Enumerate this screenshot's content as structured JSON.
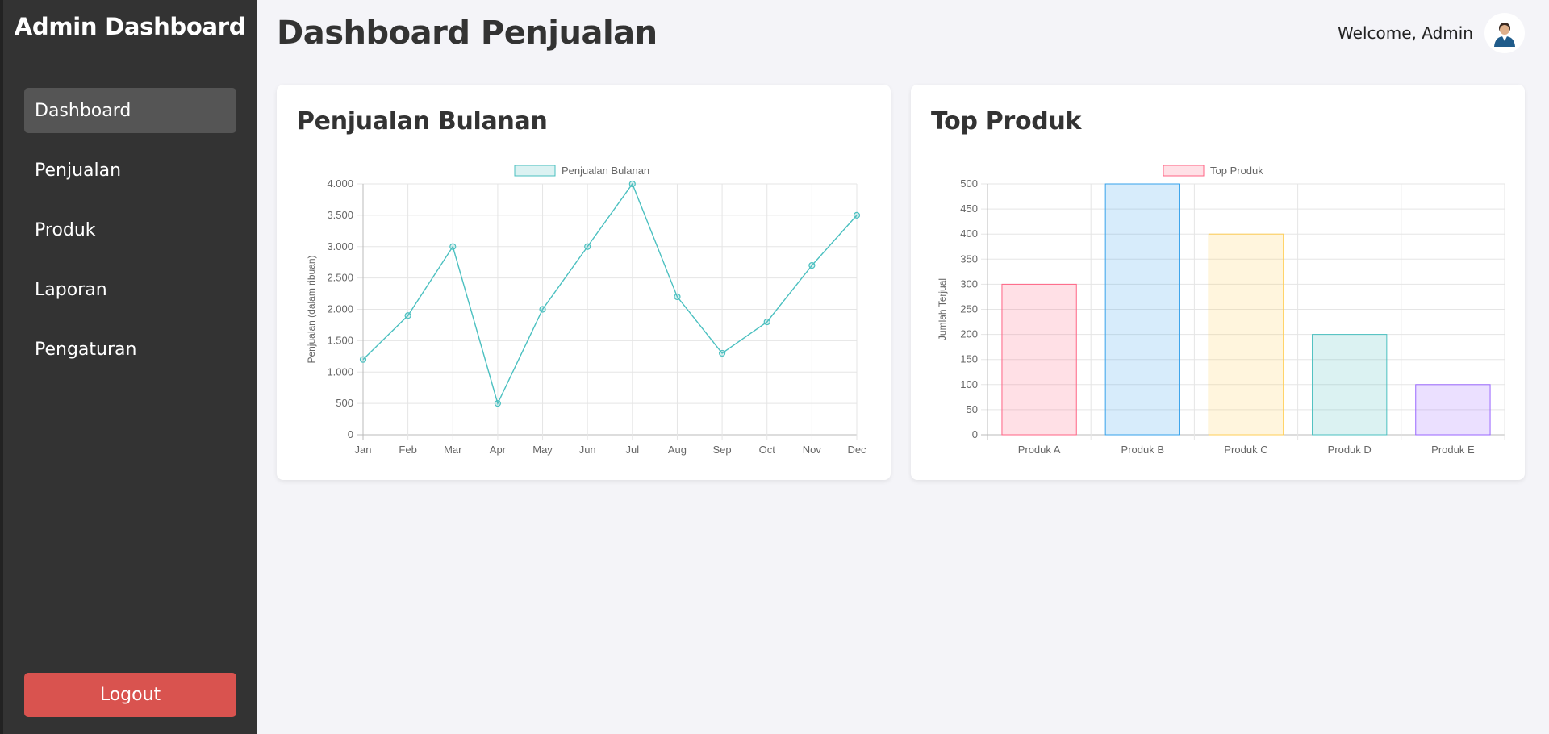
{
  "sidebar": {
    "brand": "Admin Dashboard",
    "items": [
      {
        "label": "Dashboard",
        "active": true
      },
      {
        "label": "Penjualan",
        "active": false
      },
      {
        "label": "Produk",
        "active": false
      },
      {
        "label": "Laporan",
        "active": false
      },
      {
        "label": "Pengaturan",
        "active": false
      }
    ],
    "logout_label": "Logout"
  },
  "header": {
    "title": "Dashboard Penjualan",
    "welcome": "Welcome, Admin",
    "avatar_icon": "user-avatar-icon"
  },
  "cards": {
    "monthly": {
      "title": "Penjualan Bulanan"
    },
    "top": {
      "title": "Top Produk"
    }
  },
  "colors": {
    "sidebar_bg": "#333333",
    "active_item_bg": "#555555",
    "logout_bg": "#d9534f",
    "line": "#4bc0c0",
    "line_fill": "rgba(75,192,192,0.2)"
  },
  "chart_data": [
    {
      "type": "line",
      "legend": "Penjualan Bulanan",
      "legend_position": "top",
      "categories": [
        "Jan",
        "Feb",
        "Mar",
        "Apr",
        "May",
        "Jun",
        "Jul",
        "Aug",
        "Sep",
        "Oct",
        "Nov",
        "Dec"
      ],
      "values": [
        1200,
        1900,
        3000,
        500,
        2000,
        3000,
        4000,
        2200,
        1300,
        1800,
        2700,
        3500
      ],
      "ylabel": "Penjualan (dalam ribuan)",
      "ylim": [
        0,
        4000
      ],
      "yticks": [
        "0",
        "500",
        "1.000",
        "1.500",
        "2.000",
        "2.500",
        "3.000",
        "3.500",
        "4.000"
      ],
      "grid": true,
      "color": "#4bc0c0"
    },
    {
      "type": "bar",
      "legend": "Top Produk",
      "legend_position": "top",
      "categories": [
        "Produk A",
        "Produk B",
        "Produk C",
        "Produk D",
        "Produk E"
      ],
      "values": [
        300,
        500,
        400,
        200,
        100
      ],
      "ylabel": "Jumlah Terjual",
      "ylim": [
        0,
        500
      ],
      "yticks": [
        "0",
        "50",
        "100",
        "150",
        "200",
        "250",
        "300",
        "350",
        "400",
        "450",
        "500"
      ],
      "grid": true,
      "colors": [
        {
          "fill": "rgba(255,99,132,0.2)",
          "stroke": "#ff6384"
        },
        {
          "fill": "rgba(54,162,235,0.2)",
          "stroke": "#36a2eb"
        },
        {
          "fill": "rgba(255,206,86,0.2)",
          "stroke": "#ffce56"
        },
        {
          "fill": "rgba(75,192,192,0.2)",
          "stroke": "#4bc0c0"
        },
        {
          "fill": "rgba(153,102,255,0.2)",
          "stroke": "#9966ff"
        }
      ]
    }
  ]
}
